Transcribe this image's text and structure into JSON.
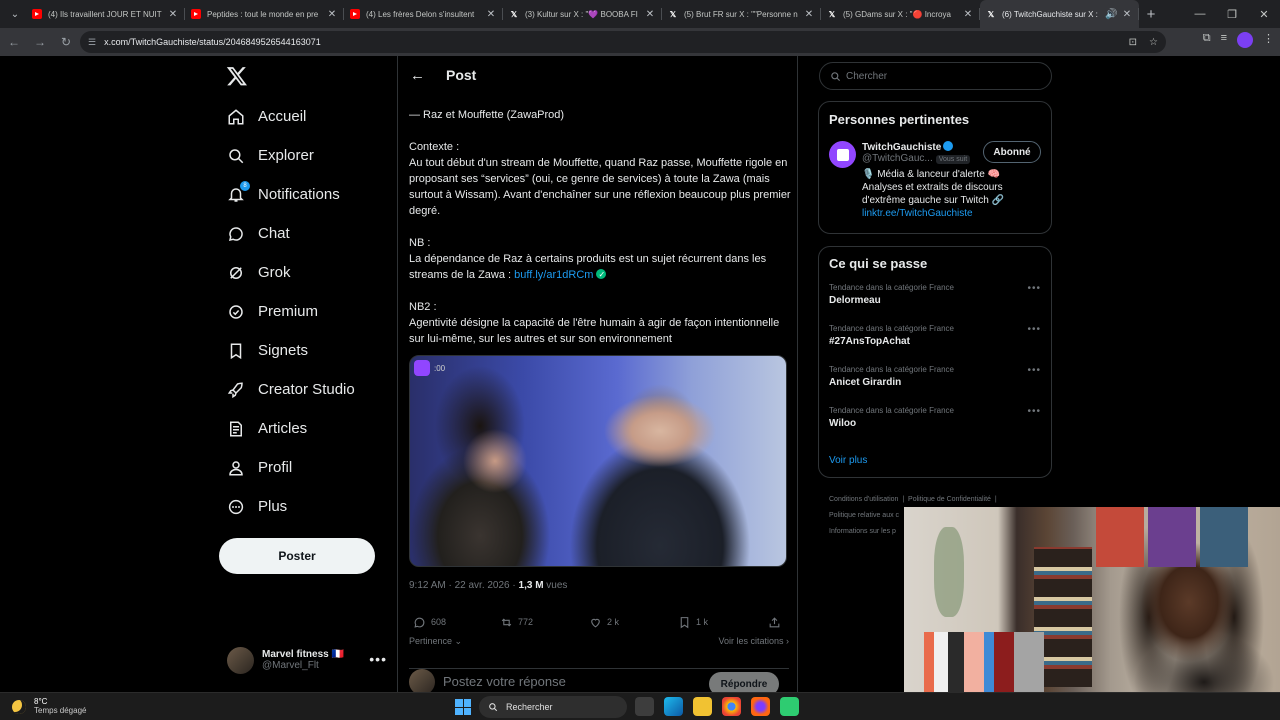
{
  "browser": {
    "tabs": [
      {
        "favicon": "youtube-icon",
        "title": "(4) Ils travaillent JOUR ET NUIT",
        "active": false
      },
      {
        "favicon": "youtube-icon",
        "title": "Peptides : tout le monde en pre",
        "active": false
      },
      {
        "favicon": "youtube-icon",
        "title": "(4) Les frères Delon s'insultent",
        "active": false
      },
      {
        "favicon": "x-icon",
        "title": "(3) Kultur sur X : \"💜 BOOBA FI",
        "active": false
      },
      {
        "favicon": "x-icon",
        "title": "(5) Brut FR sur X : \"\"Personne n",
        "active": false
      },
      {
        "favicon": "x-icon",
        "title": "(5) GDams sur X : \"🔴 Incroya",
        "active": false
      },
      {
        "favicon": "x-icon",
        "title": "(6) TwitchGauchiste sur X :",
        "active": true
      }
    ],
    "url": "x.com/TwitchGauchiste/status/2046849526544163071"
  },
  "sidebar": {
    "items": [
      {
        "label": "Accueil",
        "icon": "home-icon"
      },
      {
        "label": "Explorer",
        "icon": "search-icon"
      },
      {
        "label": "Notifications",
        "icon": "bell-icon",
        "badge": "8"
      },
      {
        "label": "Chat",
        "icon": "chat-icon"
      },
      {
        "label": "Grok",
        "icon": "grok-icon"
      },
      {
        "label": "Premium",
        "icon": "premium-icon"
      },
      {
        "label": "Signets",
        "icon": "bookmark-icon"
      },
      {
        "label": "Creator Studio",
        "icon": "rocket-icon"
      },
      {
        "label": "Articles",
        "icon": "articles-icon"
      },
      {
        "label": "Profil",
        "icon": "person-icon"
      },
      {
        "label": "Plus",
        "icon": "more-icon"
      }
    ],
    "post_button": "Poster",
    "account": {
      "name": "Marvel fitness 🇫🇷",
      "handle": "@Marvel_Flt"
    }
  },
  "post": {
    "header_title": "Post",
    "byline": "— Raz et Mouffette (ZawaProd)",
    "context_heading": "Contexte :",
    "context_text": "Au tout début d'un stream de Mouffette, quand Raz passe, Mouffette rigole en proposant ses “services” (oui, ce genre de services) à toute la Zawa (mais surtout à Wissam). Avant d'enchaîner sur une réflexion beaucoup plus premier degré.",
    "nb_heading": "NB :",
    "nb_text": "La dépendance de Raz à certains produits est un sujet récurrent dans les streams de la Zawa :",
    "nb_link": "buff.ly/ar1dRCm",
    "nb2_heading": "NB2 :",
    "nb2_text": "Agentivité désigne la capacité de l'être humain à agir de façon intentionnelle sur lui-même, sur les autres et sur son environnement",
    "media_timestamp": ":00",
    "time": "9:12 AM · 22 avr. 2026 · ",
    "views_count": "1,3 M",
    "views_label": " vues",
    "actions": {
      "replies": "608",
      "reposts": "772",
      "likes": "2 k",
      "bookmarks": "1 k"
    },
    "sort_label": "Pertinence",
    "quotes_label": "Voir les citations",
    "reply_placeholder": "Postez votre réponse",
    "reply_button": "Répondre"
  },
  "right": {
    "search_placeholder": "Chercher",
    "relevant_title": "Personnes pertinentes",
    "person": {
      "name": "TwitchGauchiste",
      "handle": "@TwitchGauc...",
      "follows_you": "Vous suit",
      "follow_button": "Abonné",
      "bio": "🎙️ Média & lanceur d'alerte 🧠 Analyses et extraits de discours d'extrême gauche sur Twitch 🔗",
      "link": "linktr.ee/TwitchGauchiste"
    },
    "trends_title": "Ce qui se passe",
    "trends": [
      {
        "category": "Tendance dans la catégorie France",
        "title": "Delormeau"
      },
      {
        "category": "Tendance dans la catégorie France",
        "title": "#27AnsTopAchat"
      },
      {
        "category": "Tendance dans la catégorie France",
        "title": "Anicet Girardin"
      },
      {
        "category": "Tendance dans la catégorie France",
        "title": "Wiloo"
      }
    ],
    "see_more": "Voir plus",
    "footer": {
      "conditions": "Conditions d'utilisation",
      "privacy": "Politique de Confidentialité",
      "cookies": "Politique relative aux c",
      "ads": "Informations sur les p"
    }
  },
  "taskbar": {
    "temperature": "8°C",
    "weather": "Temps dégagé",
    "search": "Rechercher"
  },
  "colors": {
    "accent": "#1d9bf0",
    "background": "#000000",
    "text": "#e7e9ea",
    "muted": "#71767b",
    "border": "#2f3336"
  }
}
